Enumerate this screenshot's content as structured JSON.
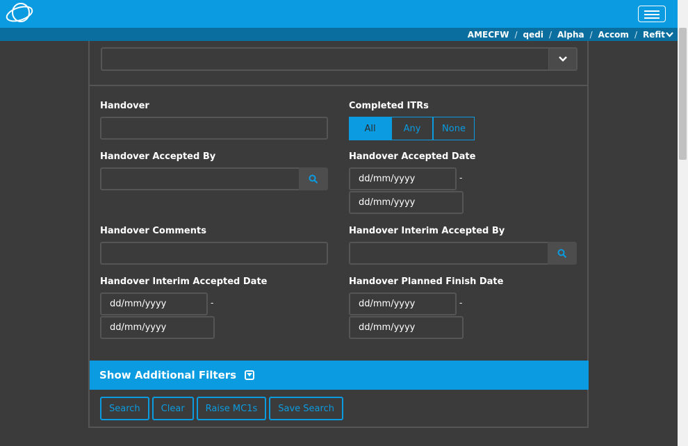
{
  "header": {
    "logo_icon": "orbit-logo-icon",
    "menu_icon": "hamburger-icon",
    "breadcrumbs": [
      "AMECFW",
      "qedi",
      "Alpha",
      "Accom",
      "Refit"
    ],
    "separator": "/",
    "accent_color": "#0a9be0"
  },
  "form": {
    "handover": {
      "label": "Handover",
      "value": ""
    },
    "completed_itrs": {
      "label": "Completed ITRs",
      "options": [
        "All",
        "Any",
        "None"
      ],
      "selected": "All"
    },
    "handover_accepted_by": {
      "label": "Handover Accepted By",
      "value": ""
    },
    "handover_accepted_date": {
      "label": "Handover Accepted Date",
      "from_placeholder": "dd/mm/yyyy",
      "to_placeholder": "dd/mm/yyyy",
      "range_sep": "-"
    },
    "handover_comments": {
      "label": "Handover Comments",
      "value": ""
    },
    "handover_interim_accepted_by": {
      "label": "Handover Interim Accepted By",
      "value": ""
    },
    "handover_interim_accepted_date": {
      "label": "Handover Interim Accepted Date",
      "from_placeholder": "dd/mm/yyyy",
      "to_placeholder": "dd/mm/yyyy",
      "range_sep": "-"
    },
    "handover_planned_finish_date": {
      "label": "Handover Planned Finish Date",
      "from_placeholder": "dd/mm/yyyy",
      "to_placeholder": "dd/mm/yyyy",
      "range_sep": "-"
    }
  },
  "filters_bar": {
    "label": "Show Additional Filters"
  },
  "actions": {
    "search": "Search",
    "clear": "Clear",
    "raise": "Raise MC1s",
    "save": "Save Search"
  }
}
